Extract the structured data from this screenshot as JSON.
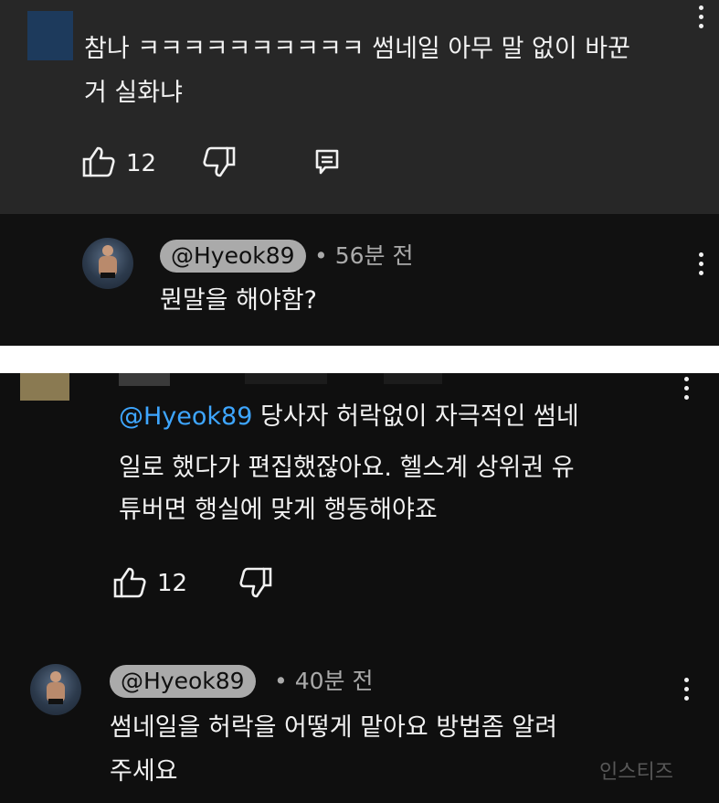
{
  "comment1": {
    "text_line1": "참나 ㅋㅋㅋㅋㅋㅋㅋㅋㅋㅋ 썸네일 아무 말 없이 바꾼",
    "text_line2": "거 실화냐",
    "likes": "12"
  },
  "reply1": {
    "handle": "@Hyeok89",
    "time": "• 56분 전",
    "text": "뭔말을 해야함?"
  },
  "comment2": {
    "mention": "@Hyeok89",
    "text_line1_rest": " 당사자 허락없이 자극적인 썸네",
    "text_line2": "일로 했다가 편집했잖아요. 헬스계 상위권 유",
    "text_line3": "튜버면 행실에 맞게 행동해야죠",
    "likes": "12"
  },
  "reply2": {
    "handle": "@Hyeok89",
    "time": "• 40분 전",
    "text_line1": "썸네일을 허락을 어떻게 맡아요 방법좀 알려",
    "text_line2": "주세요"
  },
  "watermark": "인스티즈",
  "colors": {
    "panel_top": "#272727",
    "panel_reply": "#111111",
    "background": "#0f0f0f",
    "mention": "#3ea6ff",
    "chip": "#aaaaaa",
    "text": "#f1f1f1",
    "meta": "#aaaaaa"
  },
  "icons": [
    "like-icon",
    "dislike-icon",
    "reply-icon",
    "more-options-icon"
  ]
}
